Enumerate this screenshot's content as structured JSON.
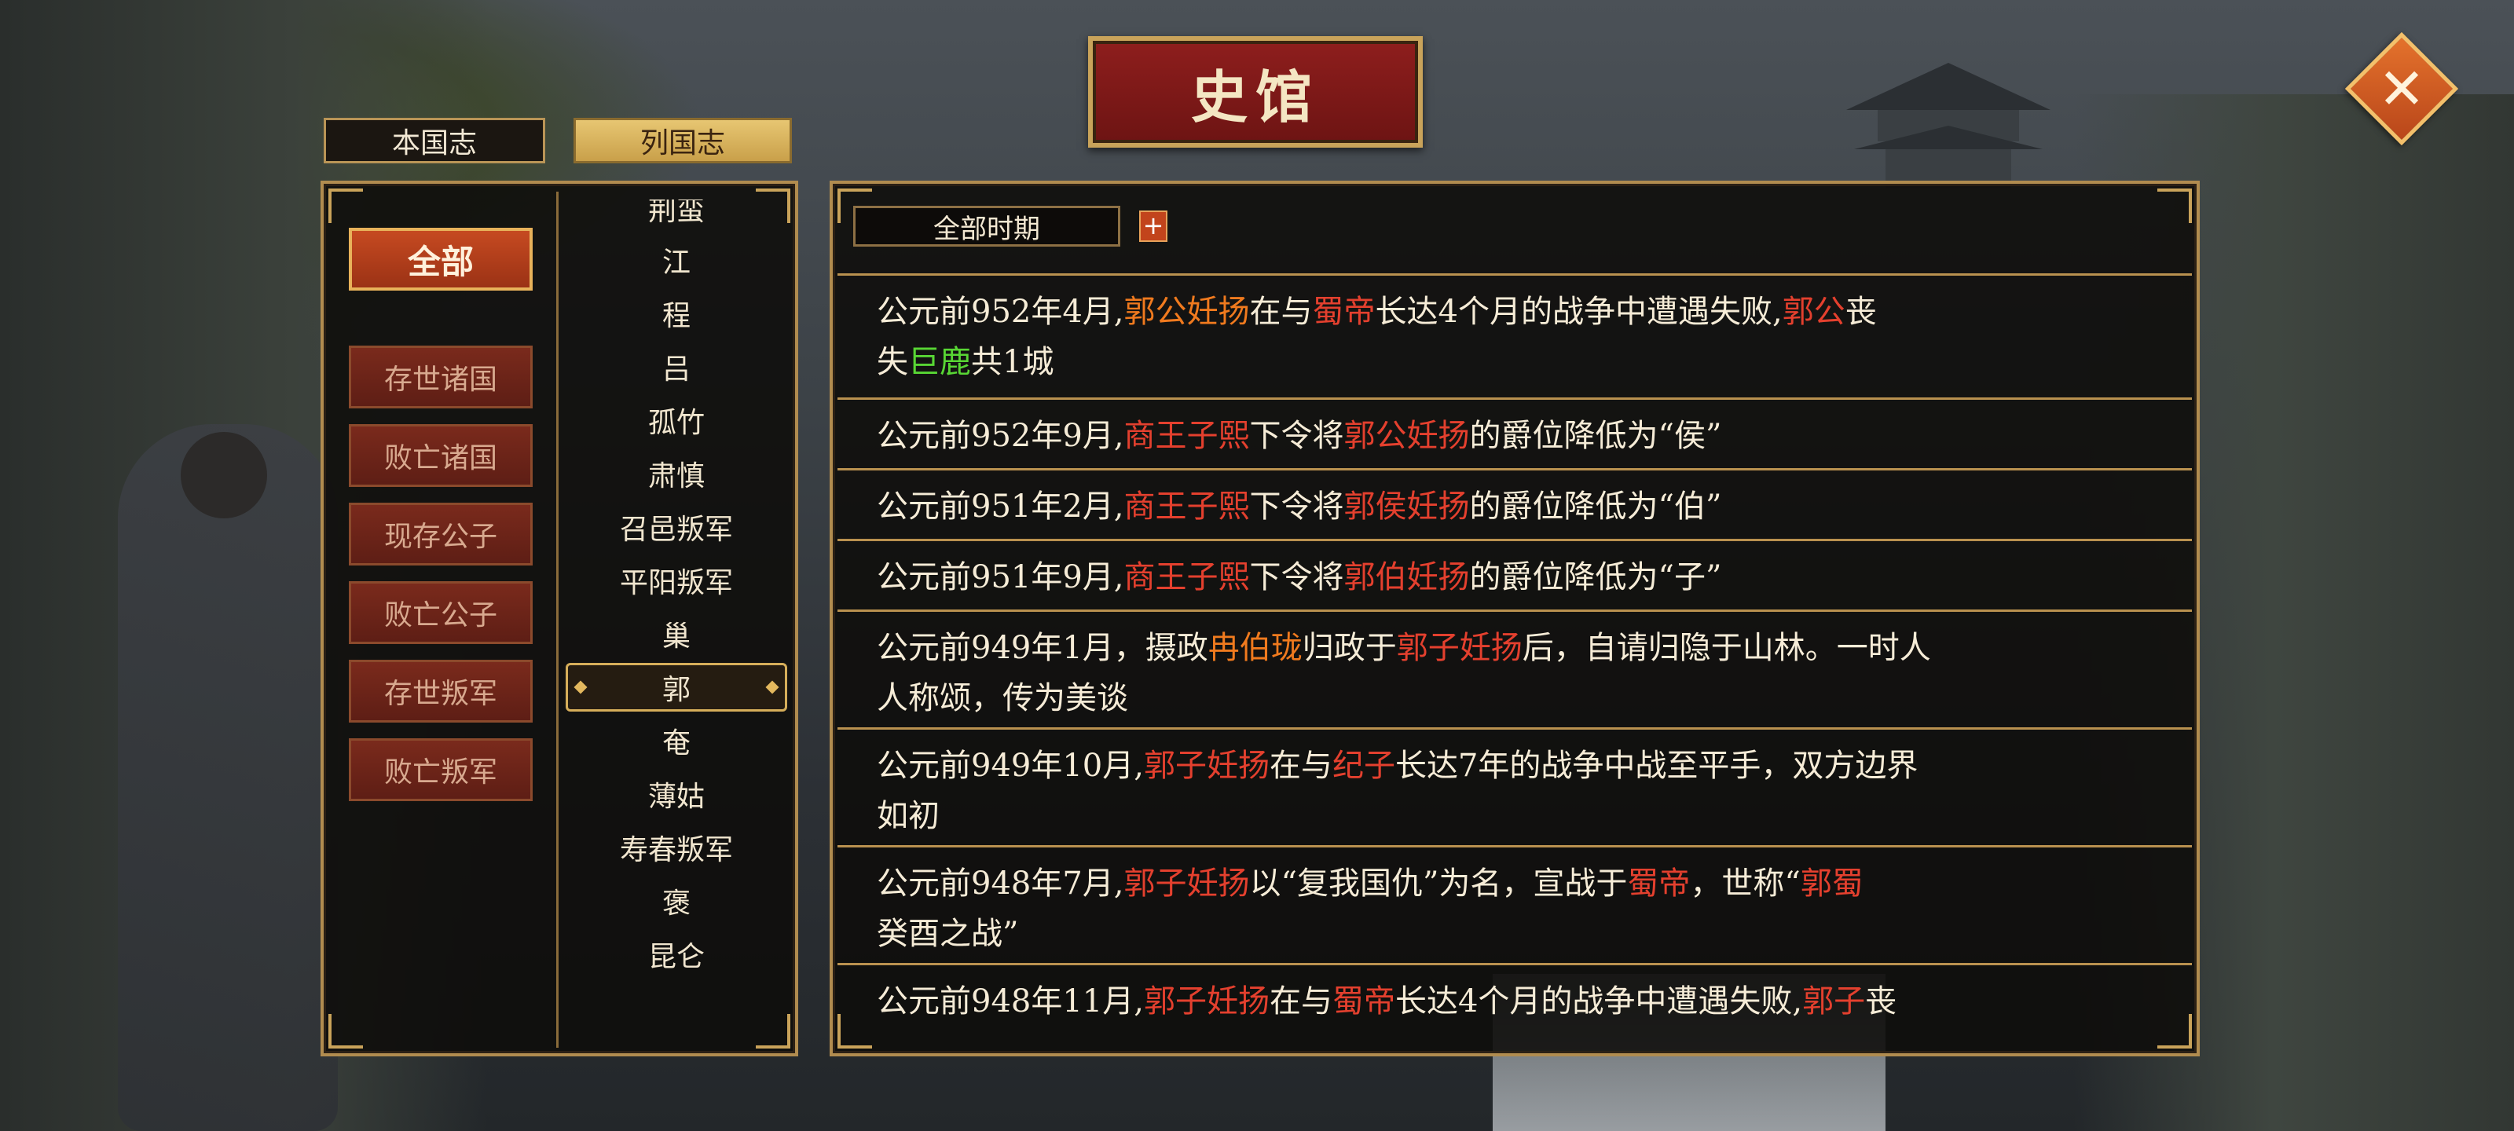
{
  "title": "史馆",
  "close_icon": "close-x-icon",
  "tabs": [
    {
      "label": "本国志",
      "active": false
    },
    {
      "label": "列国志",
      "active": true
    }
  ],
  "categories": [
    "全部",
    "存世诸国",
    "败亡诸国",
    "现存公子",
    "败亡公子",
    "存世叛军",
    "败亡叛军"
  ],
  "nations": [
    "荆蛮",
    "江",
    "程",
    "吕",
    "孤竹",
    "肃慎",
    "召邑叛军",
    "平阳叛军",
    "巢",
    "郭",
    "奄",
    "薄姑",
    "寿春叛军",
    "褒",
    "昆仑"
  ],
  "selected_nation": "郭",
  "period": {
    "label": "全部时期",
    "plus": "+"
  },
  "colors": {
    "person": "#e4402e",
    "nation": "#f07a1e",
    "city": "#58d634",
    "frame": "#b18c4f"
  },
  "records": [
    {
      "segments": [
        {
          "t": "公元前952年4月,"
        },
        {
          "t": "郭公妊扬",
          "c": "orange"
        },
        {
          "t": "在与"
        },
        {
          "t": "蜀帝",
          "c": "red"
        },
        {
          "t": "长达4个月的战争中遭遇失败,"
        },
        {
          "t": "郭公",
          "c": "red"
        },
        {
          "t": "丧"
        },
        {
          "br": true
        },
        {
          "t": "失"
        },
        {
          "t": "巨鹿",
          "c": "green"
        },
        {
          "t": "共1城"
        }
      ]
    },
    {
      "segments": [
        {
          "t": "公元前952年9月,"
        },
        {
          "t": "商王子熙",
          "c": "red"
        },
        {
          "t": "下令将"
        },
        {
          "t": "郭公妊扬",
          "c": "red"
        },
        {
          "t": "的爵位降低为“侯”"
        }
      ]
    },
    {
      "segments": [
        {
          "t": "公元前951年2月,"
        },
        {
          "t": "商王子熙",
          "c": "red"
        },
        {
          "t": "下令将"
        },
        {
          "t": "郭侯妊扬",
          "c": "red"
        },
        {
          "t": "的爵位降低为“伯”"
        }
      ]
    },
    {
      "segments": [
        {
          "t": "公元前951年9月,"
        },
        {
          "t": "商王子熙",
          "c": "red"
        },
        {
          "t": "下令将"
        },
        {
          "t": "郭伯妊扬",
          "c": "red"
        },
        {
          "t": "的爵位降低为“子”"
        }
      ]
    },
    {
      "segments": [
        {
          "t": "公元前949年1月，摄政"
        },
        {
          "t": "冉伯珑",
          "c": "orange"
        },
        {
          "t": "归政于"
        },
        {
          "t": "郭子妊扬",
          "c": "red"
        },
        {
          "t": "后，自请归隐于山林。一时人"
        },
        {
          "br": true
        },
        {
          "t": "人称颂，传为美谈"
        }
      ]
    },
    {
      "segments": [
        {
          "t": "公元前949年10月,"
        },
        {
          "t": "郭子妊扬",
          "c": "red"
        },
        {
          "t": "在与"
        },
        {
          "t": "纪子",
          "c": "red"
        },
        {
          "t": "长达7年的战争中战至平手，双方边界"
        },
        {
          "br": true
        },
        {
          "t": "如初"
        }
      ]
    },
    {
      "segments": [
        {
          "t": "公元前948年7月,"
        },
        {
          "t": "郭子妊扬",
          "c": "red"
        },
        {
          "t": "以“复我国仇”为名，宣战于"
        },
        {
          "t": "蜀帝",
          "c": "red"
        },
        {
          "t": "，世称“"
        },
        {
          "t": "郭蜀",
          "c": "red"
        },
        {
          "br": true
        },
        {
          "t": "癸酉之战”"
        }
      ]
    },
    {
      "segments": [
        {
          "t": "公元前948年11月,"
        },
        {
          "t": "郭子妊扬",
          "c": "red"
        },
        {
          "t": "在与"
        },
        {
          "t": "蜀帝",
          "c": "red"
        },
        {
          "t": "长达4个月的战争中遭遇失败,"
        },
        {
          "t": "郭子",
          "c": "red"
        },
        {
          "t": "丧"
        }
      ]
    }
  ]
}
